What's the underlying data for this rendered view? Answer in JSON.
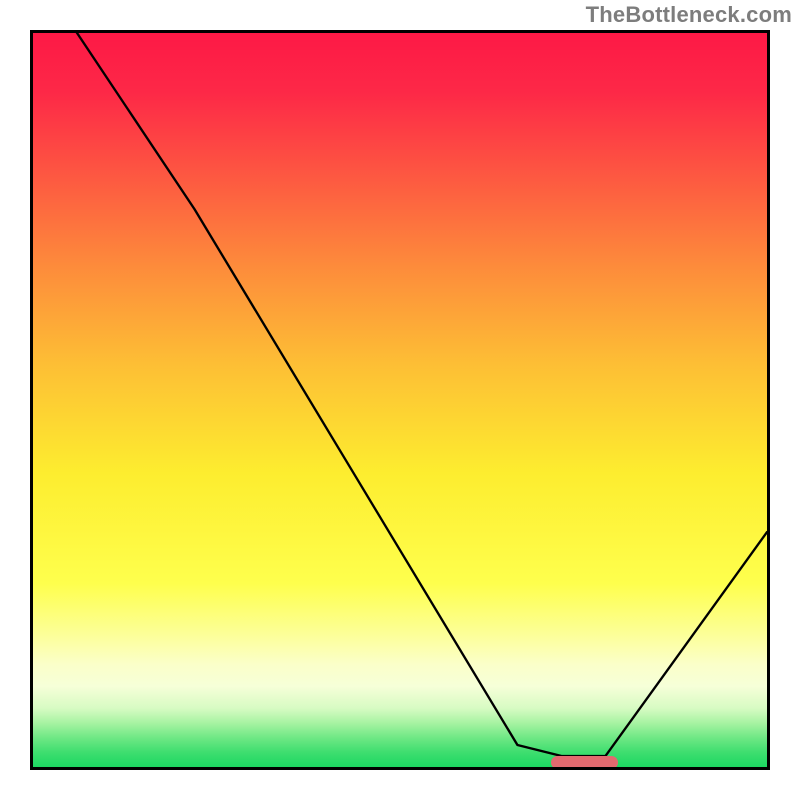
{
  "watermark": "TheBottleneck.com",
  "chart_data": {
    "type": "line",
    "title": "",
    "xlabel": "",
    "ylabel": "",
    "xlim": [
      0,
      100
    ],
    "ylim": [
      0,
      100
    ],
    "x": [
      0,
      6,
      22,
      66,
      72,
      78,
      100
    ],
    "values": [
      110,
      100,
      76,
      3,
      1.5,
      1.5,
      32
    ],
    "marker": {
      "x_start": 70,
      "x_end": 79,
      "y": 1.5
    },
    "gradient_stops": [
      {
        "offset": 0,
        "color": "#fd1946"
      },
      {
        "offset": 8,
        "color": "#fd2847"
      },
      {
        "offset": 20,
        "color": "#fd5a41"
      },
      {
        "offset": 32,
        "color": "#fd8c3b"
      },
      {
        "offset": 45,
        "color": "#fdbe35"
      },
      {
        "offset": 60,
        "color": "#fded2f"
      },
      {
        "offset": 75,
        "color": "#feff4d"
      },
      {
        "offset": 82,
        "color": "#fcff99"
      },
      {
        "offset": 86,
        "color": "#fbffc9"
      },
      {
        "offset": 89,
        "color": "#f6ffd8"
      },
      {
        "offset": 92,
        "color": "#d7fbc3"
      },
      {
        "offset": 94,
        "color": "#a7f3a2"
      },
      {
        "offset": 96,
        "color": "#6fe885"
      },
      {
        "offset": 98,
        "color": "#3ede6f"
      },
      {
        "offset": 100,
        "color": "#1cd762"
      }
    ]
  }
}
